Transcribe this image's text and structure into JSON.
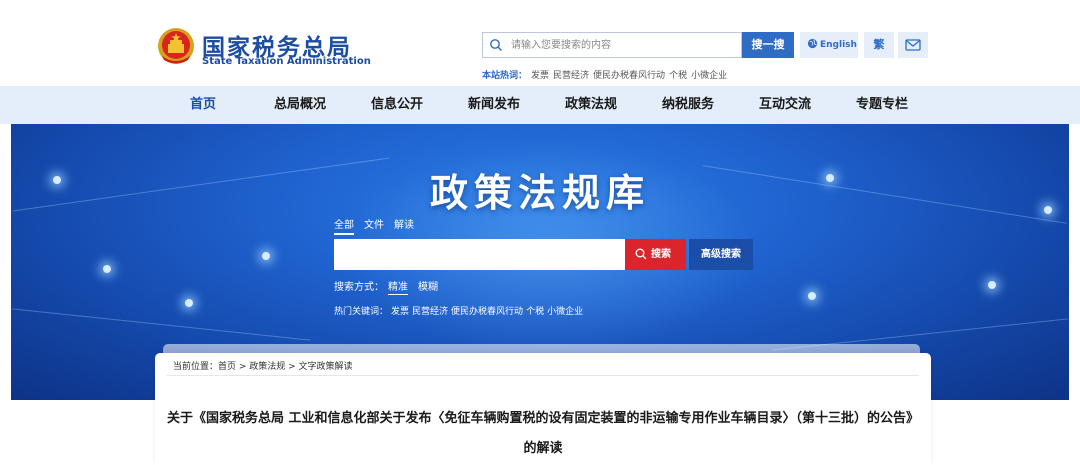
{
  "header": {
    "site_title": "国家税务总局",
    "site_subtitle": "State Taxation Administration",
    "search_placeholder": "请输入您要搜索的内容",
    "search_button": "搜一搜",
    "english_button": "English",
    "traditional_button": "繁",
    "hot_label": "本站热词：",
    "hot_words": [
      "发票",
      "民营经济",
      "便民办税春风行动",
      "个税",
      "小微企业"
    ]
  },
  "nav": {
    "items": [
      "首页",
      "总局概况",
      "信息公开",
      "新闻发布",
      "政策法规",
      "纳税服务",
      "互动交流",
      "专题专栏"
    ]
  },
  "banner": {
    "title": "政策法规库",
    "scope_tabs": [
      "全部",
      "文件",
      "解读"
    ],
    "search_button": "搜索",
    "advanced_search_button": "高级搜索",
    "search_mode_label": "搜索方式：",
    "search_modes": [
      "精准",
      "模糊"
    ],
    "hot_label": "热门关键词：",
    "hot_words": [
      "发票",
      "民营经济",
      "便民办税春风行动",
      "个税",
      "小微企业"
    ]
  },
  "content": {
    "breadcrumb": "当前位置：首页 > 政策法规 > 文字政策解读",
    "article_title": "关于《国家税务总局 工业和信息化部关于发布〈免征车辆购置税的设有固定装置的非运输专用作业车辆目录〉（第十三批）的公告》的解读"
  },
  "colors": {
    "brand_blue": "#1b4da3",
    "nav_bg": "#e3eefa",
    "search_red": "#d9252b",
    "advanced_blue": "#1a4ea8"
  }
}
